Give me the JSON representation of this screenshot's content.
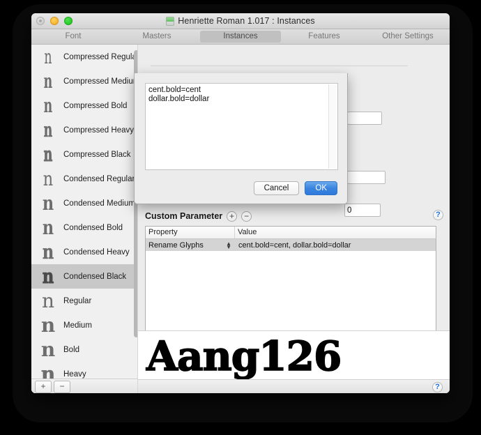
{
  "window": {
    "title": "Henriette Roman 1.017 : Instances",
    "app_icon": "app-document-icon",
    "controls": {
      "close": "close-button",
      "minimize": "minimize-button",
      "zoom": "zoom-button"
    }
  },
  "tabs": [
    {
      "label": "Font",
      "active": false
    },
    {
      "label": "Masters",
      "active": false
    },
    {
      "label": "Instances",
      "active": true
    },
    {
      "label": "Features",
      "active": false
    },
    {
      "label": "Other Settings",
      "active": false
    }
  ],
  "sidebar": {
    "glyph_sample": "n",
    "instances": [
      {
        "label": "Compressed Regular",
        "width": "compressed",
        "weight": "regular",
        "selected": false
      },
      {
        "label": "Compressed Medium",
        "width": "compressed",
        "weight": "medium",
        "selected": false
      },
      {
        "label": "Compressed Bold",
        "width": "compressed",
        "weight": "bold",
        "selected": false
      },
      {
        "label": "Compressed Heavy",
        "width": "compressed",
        "weight": "heavy",
        "selected": false
      },
      {
        "label": "Compressed Black",
        "width": "compressed",
        "weight": "black",
        "selected": false
      },
      {
        "label": "Condensed Regular",
        "width": "condensed",
        "weight": "regular",
        "selected": false
      },
      {
        "label": "Condensed Medium",
        "width": "condensed",
        "weight": "medium",
        "selected": false
      },
      {
        "label": "Condensed Bold",
        "width": "condensed",
        "weight": "bold",
        "selected": false
      },
      {
        "label": "Condensed Heavy",
        "width": "condensed",
        "weight": "heavy",
        "selected": false
      },
      {
        "label": "Condensed Black",
        "width": "condensed",
        "weight": "black",
        "selected": true
      },
      {
        "label": "Regular",
        "width": "normal",
        "weight": "regular",
        "selected": false
      },
      {
        "label": "Medium",
        "width": "normal",
        "weight": "medium",
        "selected": false
      },
      {
        "label": "Bold",
        "width": "normal",
        "weight": "bold",
        "selected": false
      },
      {
        "label": "Heavy",
        "width": "normal",
        "weight": "heavy",
        "selected": false
      }
    ],
    "footer": {
      "add_label": "+",
      "remove_label": "−"
    }
  },
  "main": {
    "background_fields": [
      {
        "name": "field-top",
        "value": ""
      },
      {
        "name": "field-middle",
        "value": ""
      },
      {
        "name": "field-bottom",
        "value": "0"
      }
    ],
    "custom_parameter": {
      "title": "Custom Parameter",
      "add_label": "+",
      "remove_label": "−",
      "help_label": "?",
      "columns": [
        "Property",
        "Value"
      ],
      "rows": [
        {
          "property": "Rename Glyphs",
          "value": "cent.bold=cent, dollar.bold=dollar"
        }
      ]
    },
    "preview": {
      "text": "Aang126"
    },
    "footer": {
      "help_label": "?"
    }
  },
  "sheet": {
    "textarea_value": "cent.bold=cent\ndollar.bold=dollar",
    "textarea_placeholder": "",
    "cancel_label": "Cancel",
    "ok_label": "OK"
  },
  "colors": {
    "accent_blue": "#3b85e0",
    "selection_gray": "#c8c8c8",
    "row_selected": "#d4d4d4",
    "help_blue": "#1b6fe0"
  }
}
